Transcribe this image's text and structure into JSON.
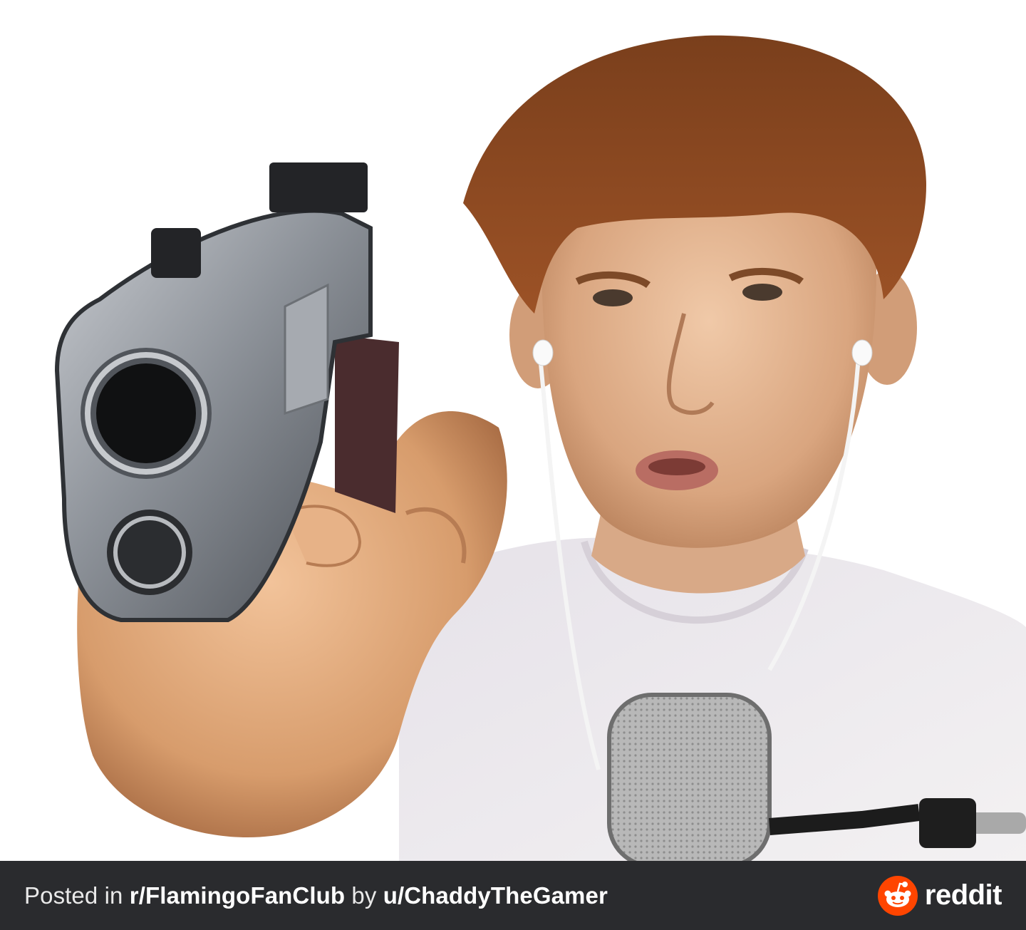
{
  "post_footer": {
    "posted_in_prefix": "Posted in ",
    "subreddit": "r/FlamingoFanClub",
    "by_text": " by ",
    "username": "u/ChaddyTheGamer",
    "brand_name": "reddit",
    "brand_icon": "reddit-snoo-icon"
  },
  "colors": {
    "footer_background": "#2a2b2e",
    "brand_orange": "#ff4500",
    "footer_text": "#ffffff"
  }
}
